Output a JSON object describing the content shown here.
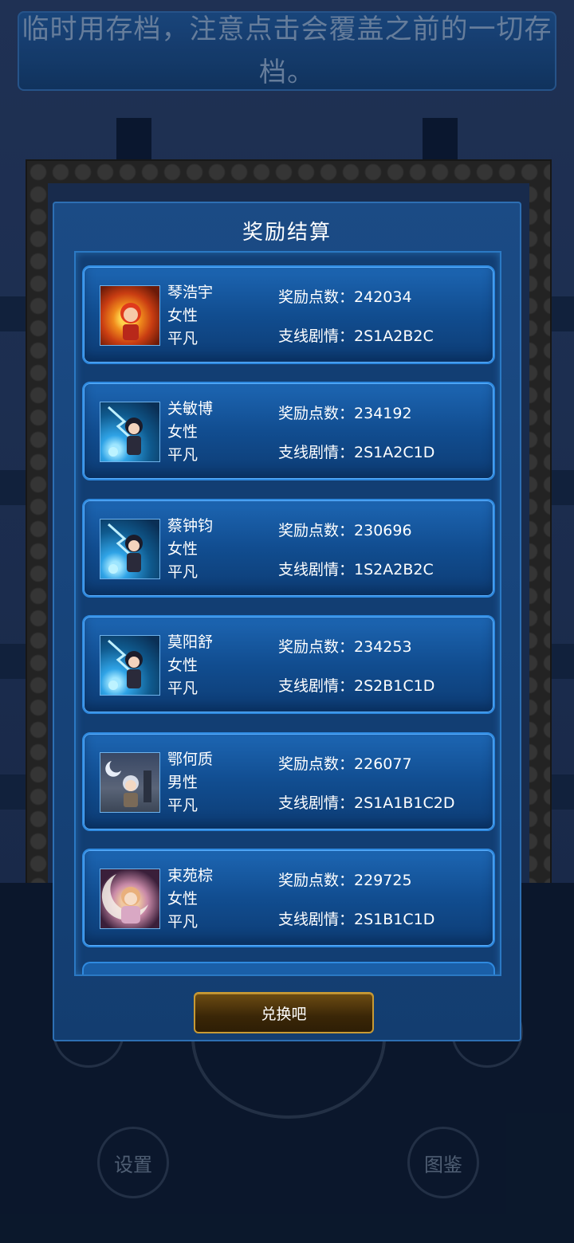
{
  "banner": {
    "line1": "临时用存档，注意点击会覆盖之前的一切存",
    "line2": "档。"
  },
  "modal": {
    "title": "奖励结算",
    "button_label": "兑换吧"
  },
  "labels": {
    "points": "奖励点数：",
    "branch": "支线剧情："
  },
  "records": [
    {
      "name": "琴浩宇",
      "gender": "女性",
      "rank": "平凡",
      "points": "242034",
      "branch": "2S1A2B2C",
      "avatar": "fire-mage-avatar"
    },
    {
      "name": "关敏博",
      "gender": "女性",
      "rank": "平凡",
      "points": "234192",
      "branch": "2S1A2C1D",
      "avatar": "lightning-warrior-avatar"
    },
    {
      "name": "蔡钟钧",
      "gender": "女性",
      "rank": "平凡",
      "points": "230696",
      "branch": "1S2A2B2C",
      "avatar": "lightning-warrior-avatar"
    },
    {
      "name": "莫阳舒",
      "gender": "女性",
      "rank": "平凡",
      "points": "234253",
      "branch": "2S2B1C1D",
      "avatar": "lightning-warrior-avatar"
    },
    {
      "name": "鄂何质",
      "gender": "男性",
      "rank": "平凡",
      "points": "226077",
      "branch": "2S1A1B1C2D",
      "avatar": "night-graveyard-avatar"
    },
    {
      "name": "束苑棕",
      "gender": "女性",
      "rank": "平凡",
      "points": "229725",
      "branch": "2S1B1C1D",
      "avatar": "moon-girl-avatar"
    }
  ],
  "background": {
    "settings_label": "设置",
    "gallery_label": "图鉴"
  }
}
